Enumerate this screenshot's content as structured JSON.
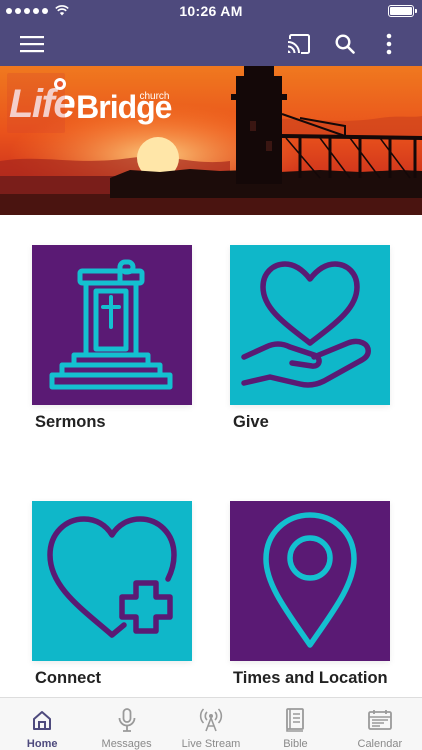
{
  "status_bar": {
    "time": "10:26 AM",
    "signal_dots": 5
  },
  "app_bar": {
    "menu_icon": "hamburger-menu-icon",
    "cast_icon": "cast-icon",
    "search_icon": "search-icon",
    "more_icon": "more-vertical-icon"
  },
  "banner": {
    "logo_life": "Life",
    "logo_bridge": "Bridge",
    "logo_church": "church"
  },
  "tiles": [
    {
      "label": "Sermons",
      "icon": "pulpit-icon",
      "color": "#5a1a74"
    },
    {
      "label": "Give",
      "icon": "heart-in-hand-icon",
      "color": "#0fb7c9"
    },
    {
      "label": "Connect",
      "icon": "heart-plus-icon",
      "color": "#0fb7c9"
    },
    {
      "label": "Times and Location",
      "icon": "map-pin-icon",
      "color": "#5a1a74"
    }
  ],
  "tabbar": {
    "items": [
      {
        "label": "Home",
        "icon": "home-icon",
        "active": true
      },
      {
        "label": "Messages",
        "icon": "microphone-icon",
        "active": false
      },
      {
        "label": "Live Stream",
        "icon": "broadcast-icon",
        "active": false
      },
      {
        "label": "Bible",
        "icon": "book-icon",
        "active": false
      },
      {
        "label": "Calendar",
        "icon": "calendar-icon",
        "active": false
      }
    ]
  },
  "colors": {
    "header": "#4e4a7d",
    "purple": "#5a1a74",
    "teal": "#0fb7c9",
    "active_tab": "#4e4a7d",
    "inactive_tab": "#8a8a8a"
  }
}
